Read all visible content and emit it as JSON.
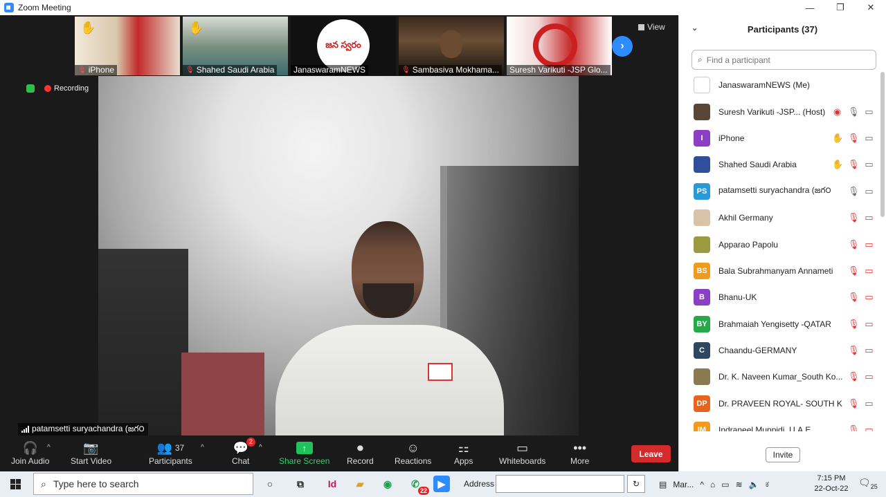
{
  "window": {
    "title": "Zoom Meeting"
  },
  "thumbnails": [
    {
      "name": "iPhone",
      "muted": true
    },
    {
      "name": "Shahed Saudi Arabia",
      "muted": true
    },
    {
      "name": "JanaswaramNEWS",
      "muted": false,
      "logo_text": "జన స్వరం"
    },
    {
      "name": "Sambasiva Mokhama...",
      "muted": true
    },
    {
      "name": "Suresh  Varikuti -JSP Glo...",
      "muted": false
    }
  ],
  "view_label": "View",
  "recording_label": "Recording",
  "active_speaker": "patamsetti suryachandra (జగ౦",
  "toolbar": {
    "join_audio": "Join Audio",
    "start_video": "Start Video",
    "participants": "Participants",
    "participants_count": "37",
    "chat": "Chat",
    "chat_badge": "2",
    "share_screen": "Share Screen",
    "record": "Record",
    "reactions": "Reactions",
    "apps": "Apps",
    "whiteboards": "Whiteboards",
    "more": "More",
    "leave": "Leave"
  },
  "panel": {
    "title": "Participants (37)",
    "search_placeholder": "Find a participant",
    "invite": "Invite",
    "participants": [
      {
        "name": "JanaswaramNEWS (Me)",
        "initials": "",
        "color": "#ffffff",
        "icons": []
      },
      {
        "name": "Suresh  Varikuti -JSP... (Host)",
        "initials": "",
        "color": "#5a4636",
        "icons": [
          "rec",
          "mic",
          "video"
        ]
      },
      {
        "name": "iPhone",
        "initials": "I",
        "color": "#8a3fc4",
        "icons": [
          "hand",
          "mic-off",
          "video"
        ]
      },
      {
        "name": "Shahed Saudi Arabia",
        "initials": "",
        "color": "#2f4f9a",
        "icons": [
          "hand-pale",
          "mic-off",
          "video"
        ]
      },
      {
        "name": "patamsetti suryachandra (జగ౦",
        "initials": "PS",
        "color": "#2a9ad6",
        "icons": [
          "mic",
          "video"
        ]
      },
      {
        "name": "Akhil Germany",
        "initials": "",
        "color": "#d9c3a8",
        "icons": [
          "mic-off",
          "video-off"
        ]
      },
      {
        "name": "Apparao Papolu",
        "initials": "",
        "color": "#9a9a40",
        "icons": [
          "mic-off",
          "video-off"
        ]
      },
      {
        "name": "Bala Subrahmanyam Annameti",
        "initials": "BS",
        "color": "#f29a1e",
        "icons": [
          "mic-off",
          "video-off"
        ]
      },
      {
        "name": "Bhanu-UK",
        "initials": "B",
        "color": "#8a3fc4",
        "icons": [
          "mic-off",
          "video-off"
        ]
      },
      {
        "name": "Brahmaiah Yengisetty -QATAR",
        "initials": "BY",
        "color": "#27a84a",
        "icons": [
          "mic-off",
          "video-off"
        ]
      },
      {
        "name": "Chaandu-GERMANY",
        "initials": "C",
        "color": "#2f4660",
        "icons": [
          "mic-off",
          "video-off"
        ]
      },
      {
        "name": "Dr. K. Naveen Kumar_South Ko...",
        "initials": "",
        "color": "#8a7a50",
        "icons": [
          "mic-off",
          "video-off"
        ]
      },
      {
        "name": "Dr. PRAVEEN ROYAL- SOUTH K...",
        "initials": "DP",
        "color": "#e8641e",
        "icons": [
          "mic-off",
          "video"
        ]
      },
      {
        "name": "Indraneel Muppidi, U.A.E",
        "initials": "IM",
        "color": "#f29a1e",
        "icons": [
          "mic-off",
          "video-off"
        ]
      }
    ]
  },
  "taskbar": {
    "search_placeholder": "Type here to search",
    "whatsapp_badge": "22",
    "address_label": "Address",
    "mar_label": "Mar...",
    "time": "7:15 PM",
    "date": "22-Oct-22",
    "notif_count": "25"
  }
}
